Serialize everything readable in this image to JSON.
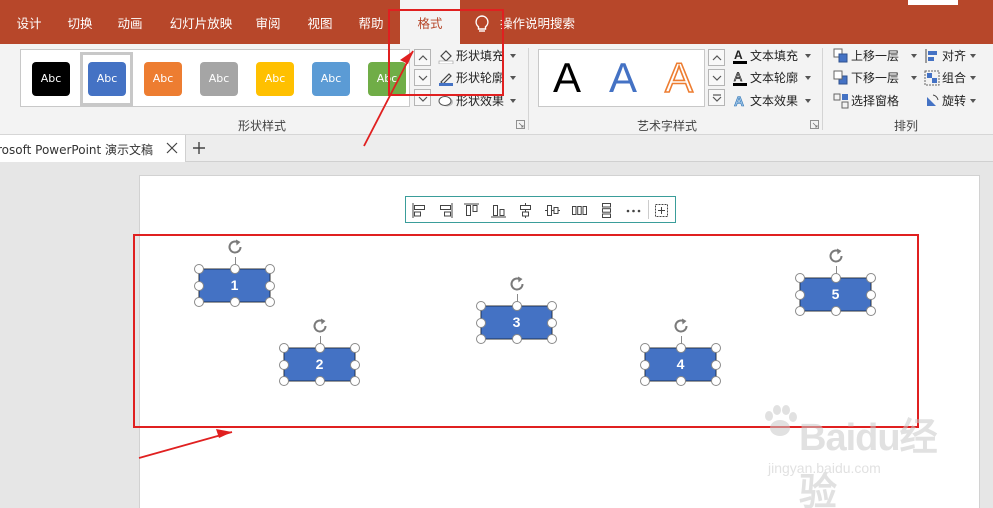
{
  "ribbon_tabs": [
    {
      "label": "设计"
    },
    {
      "label": "切换"
    },
    {
      "label": "动画"
    },
    {
      "label": "幻灯片放映"
    },
    {
      "label": "审阅"
    },
    {
      "label": "视图"
    },
    {
      "label": "帮助"
    },
    {
      "label": "格式"
    },
    {
      "label": "操作说明搜索"
    }
  ],
  "shape_styles": {
    "group_label": "形状样式",
    "swatch_text": "Abc",
    "swatches": [
      {
        "label": "Abc",
        "color": "#000000"
      },
      {
        "label": "Abc",
        "color": "#4472c4"
      },
      {
        "label": "Abc",
        "color": "#ed7d31"
      },
      {
        "label": "Abc",
        "color": "#a5a5a5"
      },
      {
        "label": "Abc",
        "color": "#ffc000"
      },
      {
        "label": "Abc",
        "color": "#5b9bd5"
      },
      {
        "label": "Abc",
        "color": "#70ad47"
      }
    ],
    "commands": [
      {
        "label": "形状填充"
      },
      {
        "label": "形状轮廓"
      },
      {
        "label": "形状效果"
      }
    ]
  },
  "wordart_styles": {
    "group_label": "艺术字样式",
    "samples": [
      "A",
      "A",
      "A"
    ],
    "commands": [
      {
        "label": "文本填充"
      },
      {
        "label": "文本轮廓"
      },
      {
        "label": "文本效果"
      }
    ]
  },
  "arrange": {
    "group_label": "排列",
    "commands": [
      {
        "label": "上移一层"
      },
      {
        "label": "下移一层"
      },
      {
        "label": "选择窗格"
      },
      {
        "label": "对齐"
      },
      {
        "label": "组合"
      },
      {
        "label": "旋转"
      }
    ]
  },
  "document_tab": {
    "title": "rosoft PowerPoint 演示文稿"
  },
  "shapes": [
    {
      "label": "1"
    },
    {
      "label": "2"
    },
    {
      "label": "3"
    },
    {
      "label": "4"
    },
    {
      "label": "5"
    }
  ],
  "watermark": {
    "line1": "Bai",
    "line1b": "du",
    "line1c": "经验",
    "line2": "jingyan.baidu.com"
  },
  "colors": {
    "accent": "#b7472a",
    "shape_fill": "#4472c4",
    "annotation_red": "#e02020",
    "align_bar_border": "#3a9d9a"
  }
}
